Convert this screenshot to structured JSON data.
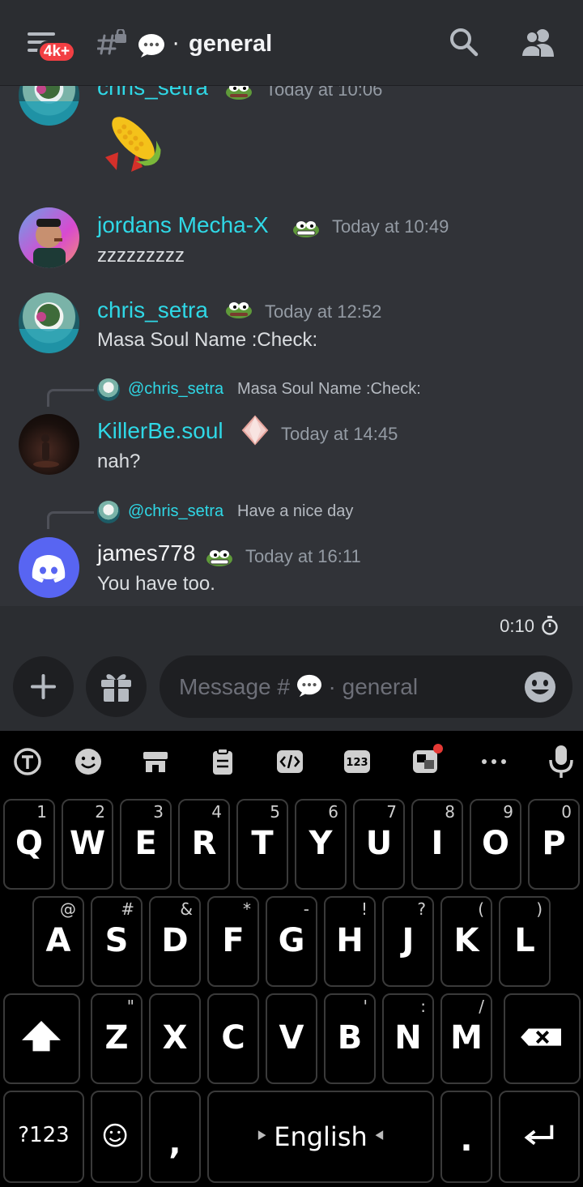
{
  "header": {
    "badge": "4k+",
    "channel_dot": "·",
    "channel_name": "general"
  },
  "messages": [
    {
      "user": "chris_setra",
      "time": "Today at 10:06",
      "text": ""
    },
    {
      "user": "jordans  Mecha-X",
      "time": "Today at 10:49",
      "text": "zzzzzzzzz"
    },
    {
      "user": "chris_setra",
      "time": "Today at 12:52",
      "text": "Masa Soul Name :Check:"
    },
    {
      "user": "KillerBe.soul",
      "time": "Today at 14:45",
      "text": "nah?",
      "reply": {
        "user": "@chris_setra",
        "text": "Masa Soul Name :Check:"
      }
    },
    {
      "user": "james778",
      "time": "Today at 16:11",
      "text": "You have too.",
      "reply": {
        "user": "@chris_setra",
        "text": "Have a nice day"
      }
    }
  ],
  "timer": {
    "value": "0:10"
  },
  "composer": {
    "placeholder_prefix": "Message #",
    "placeholder_suffix": "· general"
  },
  "keyboard": {
    "row1": [
      {
        "k": "Q",
        "h": "1"
      },
      {
        "k": "W",
        "h": "2"
      },
      {
        "k": "E",
        "h": "3"
      },
      {
        "k": "R",
        "h": "4"
      },
      {
        "k": "T",
        "h": "5"
      },
      {
        "k": "Y",
        "h": "6"
      },
      {
        "k": "U",
        "h": "7"
      },
      {
        "k": "I",
        "h": "8"
      },
      {
        "k": "O",
        "h": "9"
      },
      {
        "k": "P",
        "h": "0"
      }
    ],
    "row2": [
      {
        "k": "A",
        "h": "@"
      },
      {
        "k": "S",
        "h": "#"
      },
      {
        "k": "D",
        "h": "&"
      },
      {
        "k": "F",
        "h": "*"
      },
      {
        "k": "G",
        "h": "-"
      },
      {
        "k": "H",
        "h": "!"
      },
      {
        "k": "J",
        "h": "?"
      },
      {
        "k": "K",
        "h": "("
      },
      {
        "k": "L",
        "h": ")"
      }
    ],
    "row3": [
      {
        "k": "Z",
        "h": "\""
      },
      {
        "k": "X",
        "h": ""
      },
      {
        "k": "C",
        "h": ""
      },
      {
        "k": "V",
        "h": ""
      },
      {
        "k": "B",
        "h": "'"
      },
      {
        "k": "N",
        "h": ":"
      },
      {
        "k": "M",
        "h": "/"
      }
    ],
    "symbols_label": "?123",
    "comma": ",",
    "space_label": "English",
    "period": "."
  },
  "colors": {
    "username": "#2fd8e6",
    "background": "#313338",
    "header": "#2b2d31",
    "badge": "#f23f43",
    "discord_blurple": "#5865f2"
  }
}
